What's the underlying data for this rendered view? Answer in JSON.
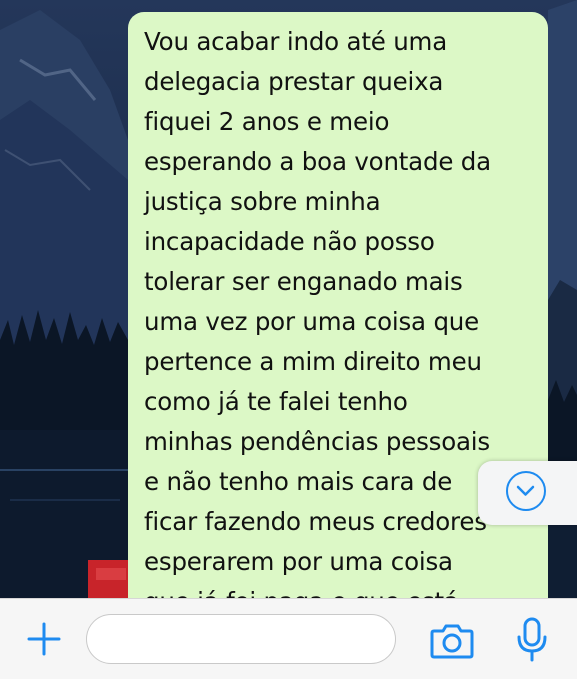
{
  "chat": {
    "message_text": "Vou acabar indo até uma\ndelegacia prestar queixa\nfiquei 2 anos e meio\nesperando a boa vontade da\njustiça sobre minha\nincapacidade não posso\ntolerar ser enganado mais\numa vez por uma coisa que\npertence a mim direito meu\ncomo já te falei tenho\nminhas pendências pessoais\ne não tenho mais cara de\nficar fazendo meus credores\nesperarem por uma coisa\nque já foi paga e que está",
    "bubble_color": "#dcf8c6"
  },
  "scroll_button": {
    "icon": "chevron-down-icon",
    "color": "#1e8bf0"
  },
  "composer": {
    "input_value": "",
    "placeholder": "",
    "icons": [
      "plus-icon",
      "camera-icon",
      "microphone-icon"
    ],
    "accent": "#1e8bf0"
  }
}
